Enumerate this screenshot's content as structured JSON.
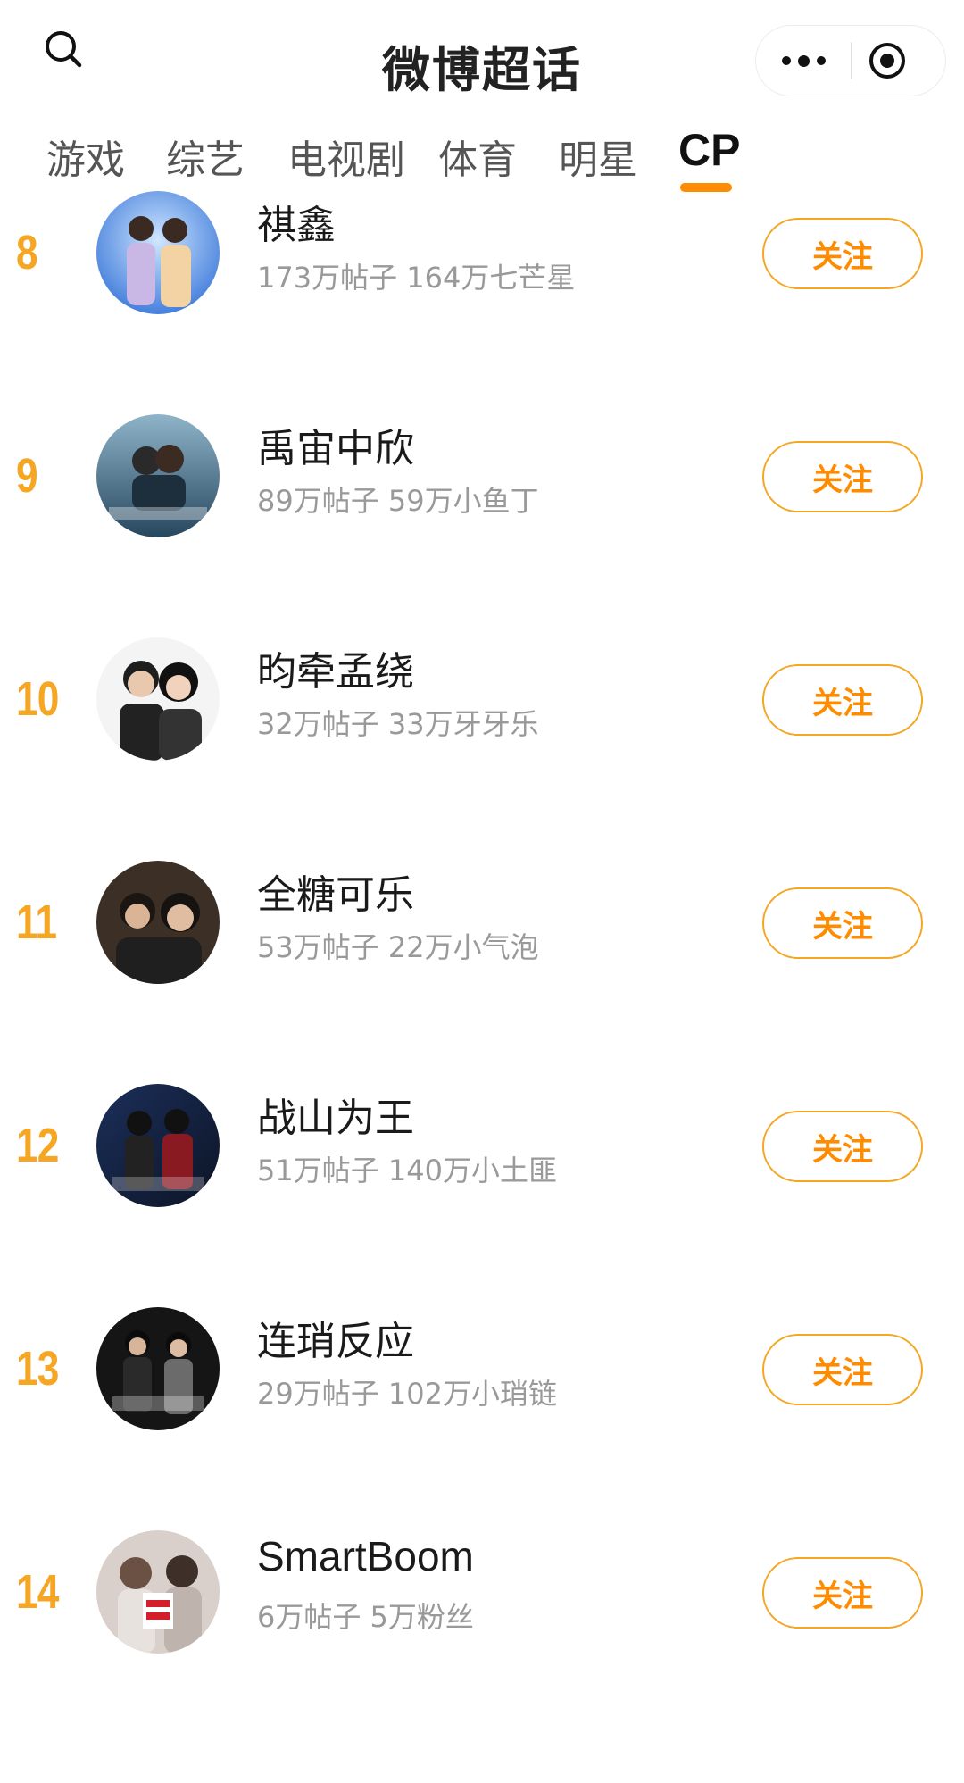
{
  "header": {
    "title": "微博超话",
    "search_icon": "search-icon",
    "more_icon": "more-dots-icon",
    "close_icon": "target-circle-icon"
  },
  "tabs": [
    {
      "label": "游戏",
      "active": false
    },
    {
      "label": "综艺",
      "active": false
    },
    {
      "label": "电视剧",
      "active": false
    },
    {
      "label": "体育",
      "active": false
    },
    {
      "label": "明星",
      "active": false
    },
    {
      "label": "CP",
      "active": true
    }
  ],
  "accent_color": "#ff8c00",
  "rank_color": "#f5a623",
  "list": [
    {
      "rank": "8",
      "name": "祺鑫",
      "stats": "173万帖子 164万七芒星",
      "button": "关注"
    },
    {
      "rank": "9",
      "name": "禹宙中欣",
      "stats": "89万帖子 59万小鱼丁",
      "button": "关注"
    },
    {
      "rank": "10",
      "name": "昀牵孟绕",
      "stats": "32万帖子 33万牙牙乐",
      "button": "关注"
    },
    {
      "rank": "11",
      "name": "全糖可乐",
      "stats": "53万帖子 22万小气泡",
      "button": "关注"
    },
    {
      "rank": "12",
      "name": "战山为王",
      "stats": "51万帖子 140万小土匪",
      "button": "关注"
    },
    {
      "rank": "13",
      "name": "连琑反应",
      "stats": "29万帖子 102万小琑链",
      "button": "关注"
    },
    {
      "rank": "14",
      "name": "SmartBoom",
      "stats": "6万帖子 5万粉丝",
      "button": "关注"
    }
  ]
}
